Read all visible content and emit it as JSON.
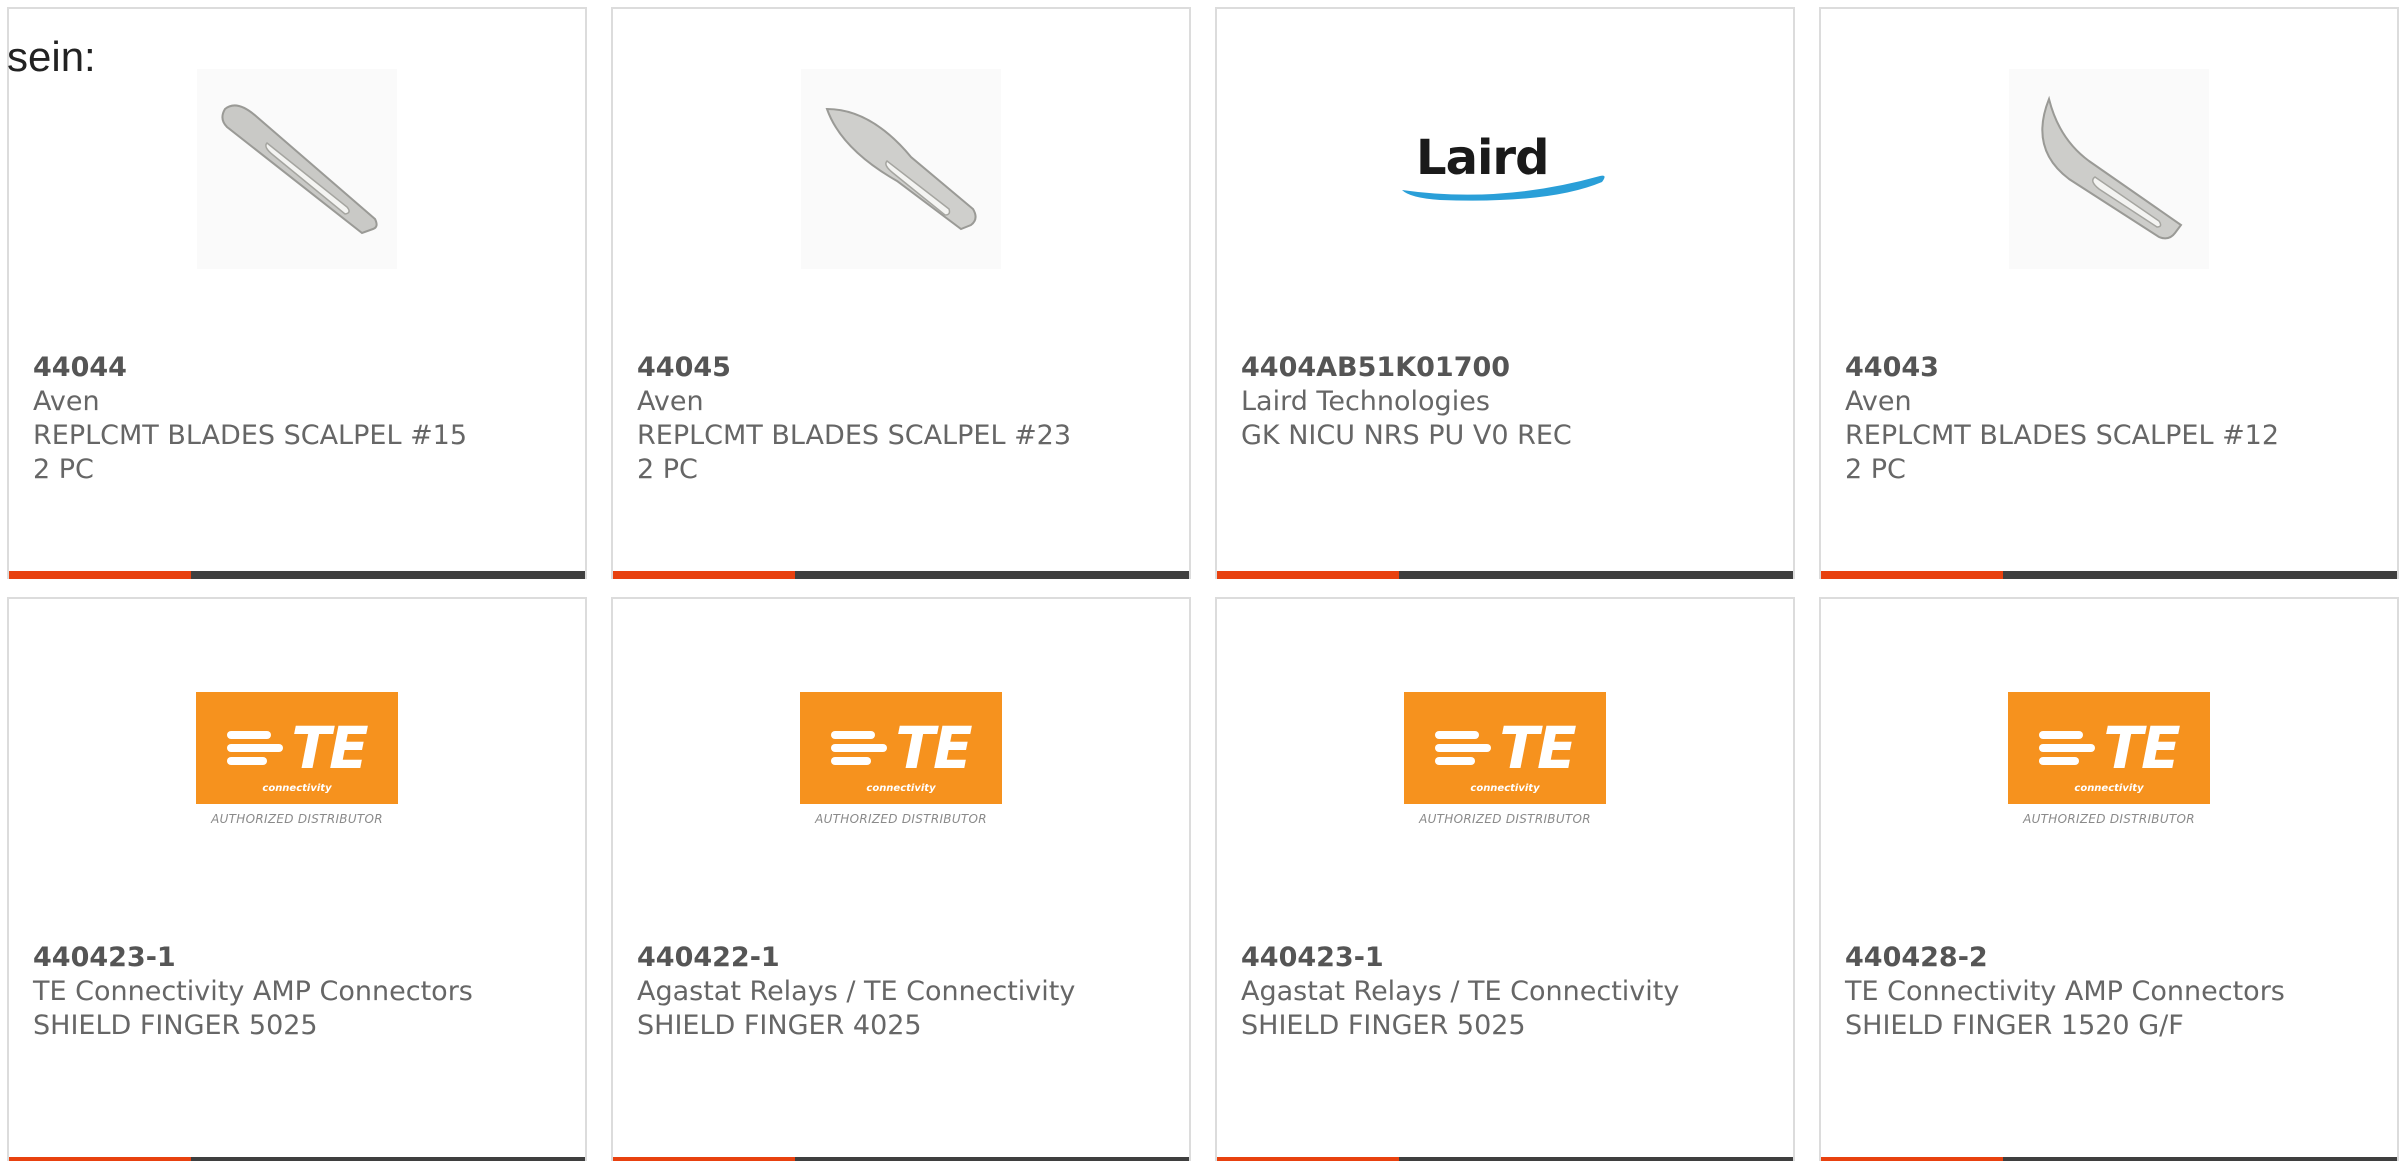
{
  "lead_text": "sein:",
  "products": [
    {
      "part_number": "44044",
      "manufacturer": "Aven",
      "description": "REPLCMT BLADES SCALPEL #15",
      "quantity": "2 PC",
      "image": "scalpel-blade-15-icon"
    },
    {
      "part_number": "44045",
      "manufacturer": "Aven",
      "description": "REPLCMT BLADES SCALPEL #23",
      "quantity": "2 PC",
      "image": "scalpel-blade-23-icon"
    },
    {
      "part_number": "4404AB51K01700",
      "manufacturer": "Laird Technologies",
      "description": "GK NICU NRS PU V0 REC",
      "image": "laird-logo"
    },
    {
      "part_number": "44043",
      "manufacturer": "Aven",
      "description": "REPLCMT BLADES SCALPEL #12",
      "quantity": "2 PC",
      "image": "scalpel-blade-12-icon"
    },
    {
      "part_number": "440423-1",
      "manufacturer": "TE Connectivity AMP Connectors",
      "description": "SHIELD FINGER 5025",
      "image": "te-connectivity-logo"
    },
    {
      "part_number": "440422-1",
      "manufacturer": "Agastat Relays / TE Connectivity",
      "description": "SHIELD FINGER 4025",
      "image": "te-connectivity-logo"
    },
    {
      "part_number": "440423-1",
      "manufacturer": "Agastat Relays / TE Connectivity",
      "description": "SHIELD FINGER 5025",
      "image": "te-connectivity-logo"
    },
    {
      "part_number": "440428-2",
      "manufacturer": "TE Connectivity AMP Connectors",
      "description": "SHIELD FINGER 1520 G/F",
      "image": "te-connectivity-logo"
    }
  ],
  "logos": {
    "laird": "Laird",
    "te_mark": "TE",
    "te_sub": "connectivity",
    "te_authorized": "AUTHORIZED DISTRIBUTOR"
  },
  "colors": {
    "accent": "#e8410f",
    "bar": "#3f3f3f",
    "te_orange": "#f6921e",
    "laird_blue": "#2a9fd8",
    "text": "#666666"
  }
}
